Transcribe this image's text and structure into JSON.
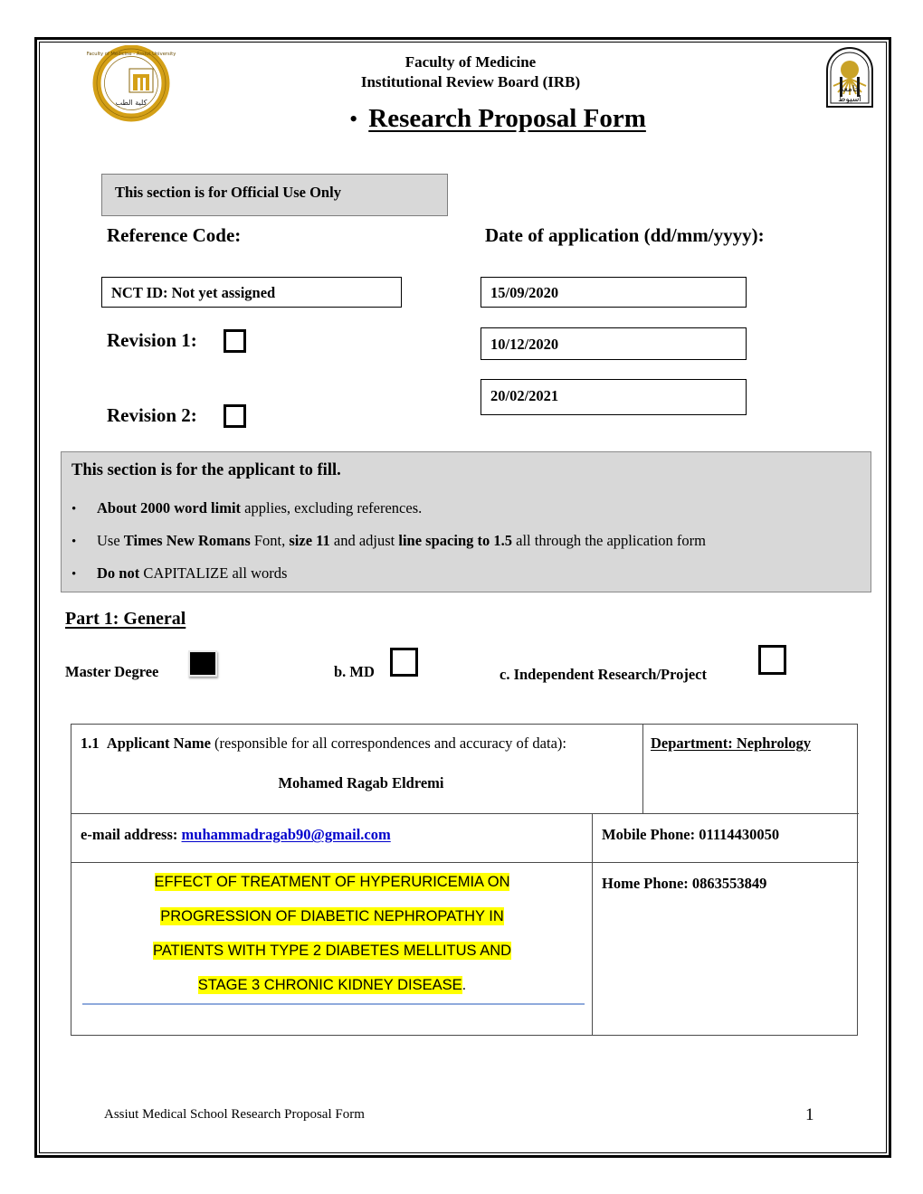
{
  "header": {
    "line1": "Faculty of Medicine",
    "line2": "Institutional Review Board (IRB)",
    "bullet": "•",
    "title": "Research Proposal Form",
    "logo_left_name": "faculty-of-medicine-assiut-logo",
    "logo_right_name": "assiut-university-logo"
  },
  "official": {
    "bar_label": "This section is for Official Use Only",
    "reference_code_label": "Reference Code:",
    "date_of_application_label": "Date of application (dd/mm/yyyy):",
    "nct_id": "NCT ID: Not yet assigned",
    "revision1_label": "Revision 1:",
    "revision2_label": "Revision 2:",
    "revision1_checked": false,
    "revision2_checked": false,
    "date1": "15/09/2020",
    "date2": "10/12/2020",
    "date3": "20/02/2021"
  },
  "applicant_instructions": {
    "heading": "This section is for the applicant to fill.",
    "bullet": "•",
    "items": [
      {
        "bold1": "About 2000 word limit",
        "rest1": " applies, excluding references.",
        "bold2": "",
        "rest2": "",
        "bold3": "",
        "rest3": ""
      },
      {
        "pre": "Use ",
        "bold1": "Times New Romans",
        "mid1": " Font, ",
        "bold2": "size 11",
        "mid2": " and adjust ",
        "bold3": "line spacing to 1.5",
        "rest3": " all through the application form"
      },
      {
        "bold1": "Do not",
        "rest1": " CAPITALIZE all words"
      }
    ]
  },
  "part1": {
    "title": "Part 1: General",
    "degree_a_label": "Master Degree",
    "degree_b_label": "b. MD",
    "degree_c_label": "c. Independent Research/Project",
    "degree_a_checked": true,
    "degree_b_checked": false,
    "degree_c_checked": false
  },
  "table": {
    "row1_number": "1.1",
    "row1_label_bold": "Applicant Name",
    "row1_label_rest": " (responsible for all correspondences and accuracy of data):",
    "applicant_name": "Mohamed Ragab Eldremi",
    "department": "Department: Nephrology",
    "email_label": "e-mail address:",
    "email_value": "muhammadragab90@gmail.com",
    "mobile_phone": "Mobile Phone:  01114430050",
    "home_phone": "Home Phone: 0863553849",
    "study_title_lines": [
      "EFFECT OF TREATMENT OF HYPERURICEMIA ON",
      "PROGRESSION OF DIABETIC NEPHROPATHY IN",
      "PATIENTS WITH TYPE 2 DIABETES MELLITUS AND",
      "STAGE 3 CHRONIC KIDNEY DISEASE"
    ],
    "study_title_trailing": ".",
    "highlight_color": "#ffff00",
    "rule_color": "#8faadc"
  },
  "footer": {
    "text": "Assiut Medical School Research Proposal Form",
    "page_number": "1"
  }
}
